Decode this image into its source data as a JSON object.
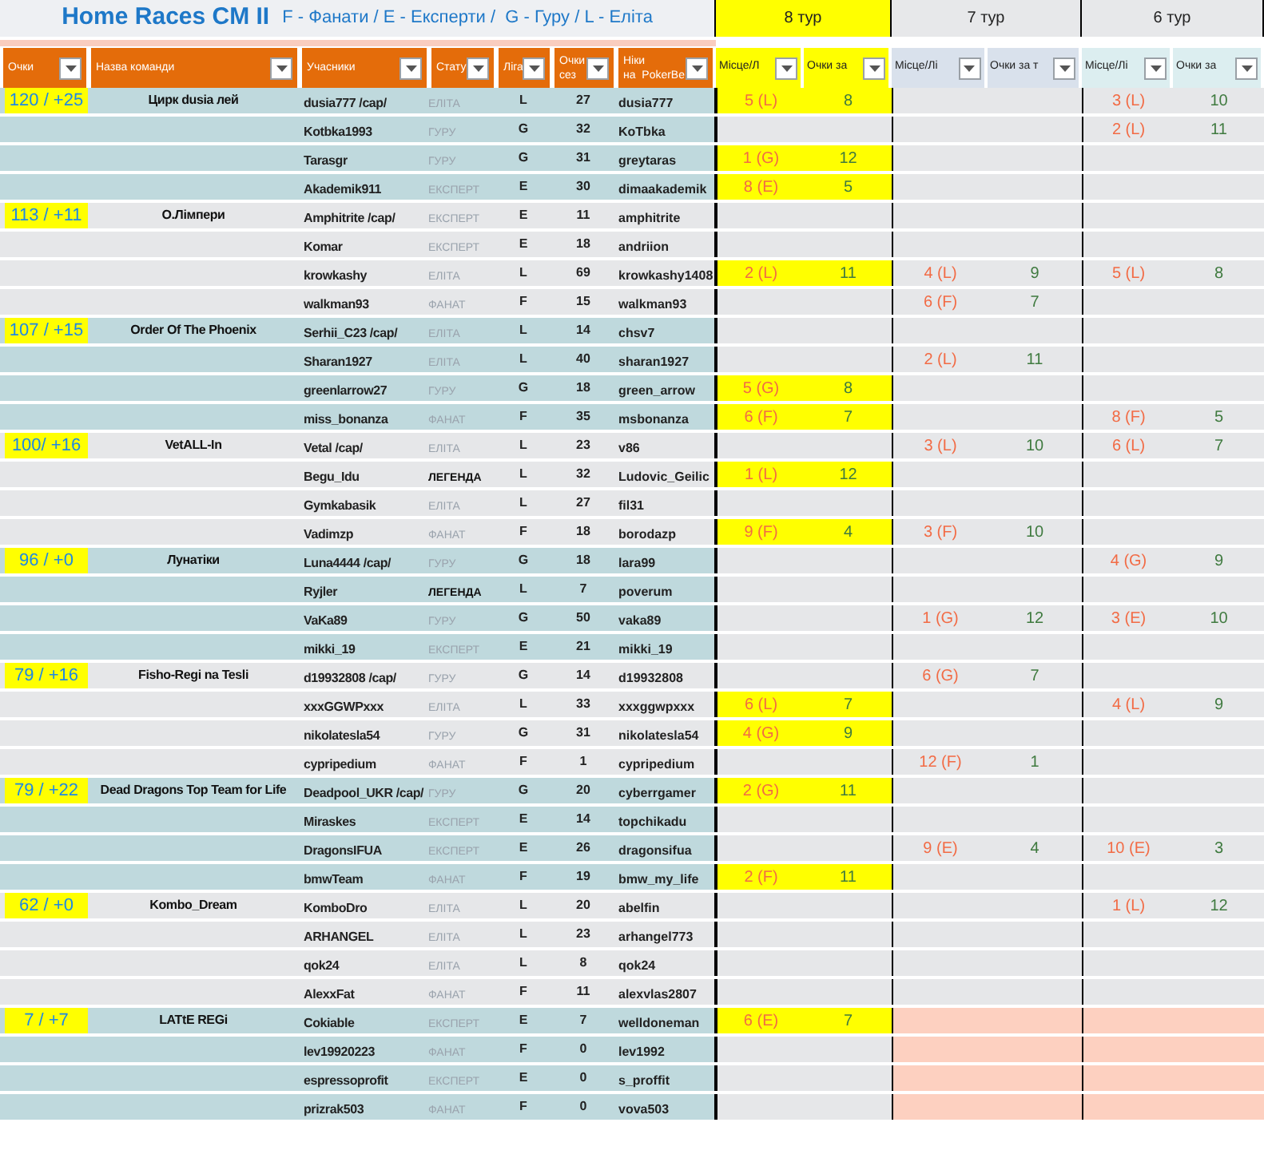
{
  "title": "Home Races CM II",
  "legend": "F - Фанати / E - Експерти /  G - Гуру / L - Еліта",
  "columns": [
    "Очки",
    "Назва команди",
    "Учасники",
    "Стату",
    "Ліга",
    "Очки\nсез",
    "Ніки\nна  PokerBe"
  ],
  "tours": [
    {
      "label": "8 тур",
      "current": true,
      "color": "#ffff00",
      "place_header": "Місце/Л",
      "points_header": "Очки за"
    },
    {
      "label": "7 тур",
      "current": false,
      "color": "#d9e1ec",
      "place_header": "Місце/Лі",
      "points_header": "Очки за т"
    },
    {
      "label": "6 тур",
      "current": false,
      "color": "#dceef0",
      "place_header": "Місце/Лі",
      "points_header": "Очки за"
    }
  ],
  "teams": [
    {
      "score": "120 / +25",
      "name": "Цирк dusia лей",
      "members": [
        {
          "name": "dusia777 /cap/",
          "status": "ЕЛІТА",
          "status_bold": false,
          "league": "L",
          "season": "27",
          "nick": "dusia777",
          "rounds": [
            {
              "kind": "result",
              "place": "5 (L)",
              "points": "8"
            },
            {
              "kind": "empty"
            },
            {
              "kind": "result",
              "place": "3 (L)",
              "points": "10"
            }
          ]
        },
        {
          "name": "Kotbka1993",
          "status": "ГУРУ",
          "status_bold": false,
          "league": "G",
          "season": "32",
          "nick": "KoTbka",
          "rounds": [
            {
              "kind": "empty"
            },
            {
              "kind": "empty"
            },
            {
              "kind": "result",
              "place": "2 (L)",
              "points": "11"
            }
          ]
        },
        {
          "name": "Tarasgr",
          "status": "ГУРУ",
          "status_bold": false,
          "league": "G",
          "season": "31",
          "nick": "greytaras",
          "rounds": [
            {
              "kind": "result",
              "place": "1 (G)",
              "points": "12"
            },
            {
              "kind": "empty"
            },
            {
              "kind": "empty"
            }
          ]
        },
        {
          "name": "Akademik911",
          "status": "ЕКСПЕРТ",
          "status_bold": false,
          "league": "E",
          "season": "30",
          "nick": "dimaakademik",
          "rounds": [
            {
              "kind": "result",
              "place": "8 (E)",
              "points": "5"
            },
            {
              "kind": "empty"
            },
            {
              "kind": "empty"
            }
          ]
        }
      ]
    },
    {
      "score": "113 / +11",
      "name": "О.Лімпери",
      "members": [
        {
          "name": "Amphitrite /cap/",
          "status": "ЕКСПЕРТ",
          "status_bold": false,
          "league": "E",
          "season": "11",
          "nick": "amphitrite",
          "rounds": [
            {
              "kind": "empty"
            },
            {
              "kind": "empty"
            },
            {
              "kind": "empty"
            }
          ]
        },
        {
          "name": "Komar",
          "status": "ЕКСПЕРТ",
          "status_bold": false,
          "league": "E",
          "season": "18",
          "nick": "andriion",
          "rounds": [
            {
              "kind": "empty"
            },
            {
              "kind": "empty"
            },
            {
              "kind": "empty"
            }
          ]
        },
        {
          "name": "krowkashy",
          "status": "ЕЛІТА",
          "status_bold": false,
          "league": "L",
          "season": "69",
          "nick": "krowkashy1408",
          "rounds": [
            {
              "kind": "result",
              "place": "2 (L)",
              "points": "11"
            },
            {
              "kind": "result",
              "place": "4 (L)",
              "points": "9"
            },
            {
              "kind": "result",
              "place": "5 (L)",
              "points": "8"
            }
          ]
        },
        {
          "name": "walkman93",
          "status": "ФАНАТ",
          "status_bold": false,
          "league": "F",
          "season": "15",
          "nick": "walkman93",
          "rounds": [
            {
              "kind": "empty"
            },
            {
              "kind": "result",
              "place": "6 (F)",
              "points": "7"
            },
            {
              "kind": "empty"
            }
          ]
        }
      ]
    },
    {
      "score": "107 / +15",
      "name": "Order Of The Phoenix",
      "members": [
        {
          "name": "Serhii_C23 /cap/",
          "status": "ЕЛІТА",
          "status_bold": false,
          "league": "L",
          "season": "14",
          "nick": "chsv7",
          "rounds": [
            {
              "kind": "empty"
            },
            {
              "kind": "empty"
            },
            {
              "kind": "empty"
            }
          ]
        },
        {
          "name": "Sharan1927",
          "status": "ЕЛІТА",
          "status_bold": false,
          "league": "L",
          "season": "40",
          "nick": "sharan1927",
          "rounds": [
            {
              "kind": "empty"
            },
            {
              "kind": "result",
              "place": "2 (L)",
              "points": "11"
            },
            {
              "kind": "empty"
            }
          ]
        },
        {
          "name": "greenlarrow27",
          "status": "ГУРУ",
          "status_bold": false,
          "league": "G",
          "season": "18",
          "nick": "green_arrow",
          "rounds": [
            {
              "kind": "result",
              "place": "5 (G)",
              "points": "8"
            },
            {
              "kind": "empty"
            },
            {
              "kind": "empty"
            }
          ]
        },
        {
          "name": "miss_bonanza",
          "status": "ФАНАТ",
          "status_bold": false,
          "league": "F",
          "season": "35",
          "nick": "msbonanza",
          "rounds": [
            {
              "kind": "result",
              "place": "6 (F)",
              "points": "7"
            },
            {
              "kind": "empty"
            },
            {
              "kind": "result",
              "place": "8 (F)",
              "points": "5"
            }
          ]
        }
      ]
    },
    {
      "score": "100/ +16",
      "name": "VetALL-In",
      "members": [
        {
          "name": "Vetal /cap/",
          "status": "ЕЛІТА",
          "status_bold": false,
          "league": "L",
          "season": "23",
          "nick": "v86",
          "rounds": [
            {
              "kind": "empty"
            },
            {
              "kind": "result",
              "place": "3 (L)",
              "points": "10"
            },
            {
              "kind": "result",
              "place": "6 (L)",
              "points": "7"
            }
          ]
        },
        {
          "name": "Begu_Idu",
          "status": "ЛЕГЕНДА",
          "status_bold": true,
          "league": "L",
          "season": "32",
          "nick": "Ludovic_Geilic",
          "rounds": [
            {
              "kind": "result",
              "place": "1 (L)",
              "points": "12"
            },
            {
              "kind": "empty"
            },
            {
              "kind": "empty"
            }
          ]
        },
        {
          "name": "Gymkabasik",
          "status": "ЕЛІТА",
          "status_bold": false,
          "league": "L",
          "season": "27",
          "nick": "fil31",
          "rounds": [
            {
              "kind": "empty"
            },
            {
              "kind": "empty"
            },
            {
              "kind": "empty"
            }
          ]
        },
        {
          "name": "Vadimzp",
          "status": "ФАНАТ",
          "status_bold": false,
          "league": "F",
          "season": "18",
          "nick": "borodazp",
          "rounds": [
            {
              "kind": "result",
              "place": "9 (F)",
              "points": "4"
            },
            {
              "kind": "result",
              "place": "3 (F)",
              "points": "10"
            },
            {
              "kind": "empty"
            }
          ]
        }
      ]
    },
    {
      "score": "96 / +0",
      "name": "Лунатіки",
      "members": [
        {
          "name": "Luna4444 /cap/",
          "status": "ГУРУ",
          "status_bold": false,
          "league": "G",
          "season": "18",
          "nick": "lara99",
          "rounds": [
            {
              "kind": "empty"
            },
            {
              "kind": "empty"
            },
            {
              "kind": "result",
              "place": "4 (G)",
              "points": "9"
            }
          ]
        },
        {
          "name": "Ryjler",
          "status": "ЛЕГЕНДА",
          "status_bold": true,
          "league": "L",
          "season": "7",
          "nick": "poverum",
          "rounds": [
            {
              "kind": "empty"
            },
            {
              "kind": "empty"
            },
            {
              "kind": "empty"
            }
          ]
        },
        {
          "name": "VaKa89",
          "status": "ГУРУ",
          "status_bold": false,
          "league": "G",
          "season": "50",
          "nick": "vaka89",
          "rounds": [
            {
              "kind": "empty"
            },
            {
              "kind": "result",
              "place": "1 (G)",
              "points": "12"
            },
            {
              "kind": "result",
              "place": "3 (E)",
              "points": "10"
            }
          ]
        },
        {
          "name": "mikki_19",
          "status": "ЕКСПЕРТ",
          "status_bold": false,
          "league": "E",
          "season": "21",
          "nick": "mikki_19",
          "rounds": [
            {
              "kind": "empty"
            },
            {
              "kind": "empty"
            },
            {
              "kind": "empty"
            }
          ]
        }
      ]
    },
    {
      "score": "79 / +16",
      "name": "Fisho-Regi na Tesli",
      "members": [
        {
          "name": "d19932808 /cap/",
          "status": "ГУРУ",
          "status_bold": false,
          "league": "G",
          "season": "14",
          "nick": "d19932808",
          "rounds": [
            {
              "kind": "empty"
            },
            {
              "kind": "result",
              "place": "6 (G)",
              "points": "7"
            },
            {
              "kind": "empty"
            }
          ]
        },
        {
          "name": "xxxGGWPxxx",
          "status": "ЕЛІТА",
          "status_bold": false,
          "league": "L",
          "season": "33",
          "nick": "xxxggwpxxx",
          "rounds": [
            {
              "kind": "result",
              "place": "6 (L)",
              "points": "7"
            },
            {
              "kind": "empty"
            },
            {
              "kind": "result",
              "place": "4 (L)",
              "points": "9"
            }
          ]
        },
        {
          "name": "nikolatesla54",
          "status": "ГУРУ",
          "status_bold": false,
          "league": "G",
          "season": "31",
          "nick": "nikolatesla54",
          "rounds": [
            {
              "kind": "result",
              "place": "4 (G)",
              "points": "9"
            },
            {
              "kind": "empty"
            },
            {
              "kind": "empty"
            }
          ]
        },
        {
          "name": "cypripedium",
          "status": "ФАНАТ",
          "status_bold": false,
          "league": "F",
          "season": "1",
          "nick": "cypripedium",
          "rounds": [
            {
              "kind": "empty"
            },
            {
              "kind": "result",
              "place": "12 (F)",
              "points": "1"
            },
            {
              "kind": "empty"
            }
          ]
        }
      ]
    },
    {
      "score": "79 / +22",
      "name": "Dead Dragons Top Team for Life",
      "members": [
        {
          "name": "Deadpool_UKR /cap/",
          "status": "ГУРУ",
          "status_bold": false,
          "league": "G",
          "season": "20",
          "nick": "cyberrgamer",
          "rounds": [
            {
              "kind": "result",
              "place": "2 (G)",
              "points": "11"
            },
            {
              "kind": "empty"
            },
            {
              "kind": "empty"
            }
          ]
        },
        {
          "name": "Miraskes",
          "status": "ЕКСПЕРТ",
          "status_bold": false,
          "league": "E",
          "season": "14",
          "nick": "topchikadu",
          "rounds": [
            {
              "kind": "empty"
            },
            {
              "kind": "empty"
            },
            {
              "kind": "empty"
            }
          ]
        },
        {
          "name": "DragonsIFUA",
          "status": "ЕКСПЕРТ",
          "status_bold": false,
          "league": "E",
          "season": "26",
          "nick": "dragonsifua",
          "rounds": [
            {
              "kind": "empty"
            },
            {
              "kind": "result",
              "place": "9 (E)",
              "points": "4"
            },
            {
              "kind": "result",
              "place": "10 (E)",
              "points": "3"
            }
          ]
        },
        {
          "name": "bmwTeam",
          "status": "ФАНАТ",
          "status_bold": false,
          "league": "F",
          "season": "19",
          "nick": "bmw_my_life",
          "rounds": [
            {
              "kind": "result",
              "place": "2 (F)",
              "points": "11"
            },
            {
              "kind": "empty"
            },
            {
              "kind": "empty"
            }
          ]
        }
      ]
    },
    {
      "score": "62 / +0",
      "name": "Kombo_Dream",
      "members": [
        {
          "name": "KomboDro",
          "status": "ЕЛІТА",
          "status_bold": false,
          "league": "L",
          "season": "20",
          "nick": "abelfin",
          "rounds": [
            {
              "kind": "empty"
            },
            {
              "kind": "empty"
            },
            {
              "kind": "result",
              "place": "1 (L)",
              "points": "12"
            }
          ]
        },
        {
          "name": "ARHANGEL",
          "status": "ЕЛІТА",
          "status_bold": false,
          "league": "L",
          "season": "23",
          "nick": "arhangel773",
          "rounds": [
            {
              "kind": "empty"
            },
            {
              "kind": "empty"
            },
            {
              "kind": "empty"
            }
          ]
        },
        {
          "name": "qok24",
          "status": "ЕЛІТА",
          "status_bold": false,
          "league": "L",
          "season": "8",
          "nick": "qok24",
          "rounds": [
            {
              "kind": "empty"
            },
            {
              "kind": "empty"
            },
            {
              "kind": "empty"
            }
          ]
        },
        {
          "name": "AlexxFat",
          "status": "ФАНАТ",
          "status_bold": false,
          "league": "F",
          "season": "11",
          "nick": "alexvlas2807",
          "rounds": [
            {
              "kind": "empty"
            },
            {
              "kind": "empty"
            },
            {
              "kind": "empty"
            }
          ]
        }
      ]
    },
    {
      "score": "7 / +7",
      "name": "LATtE REGi",
      "members": [
        {
          "name": "Cokiable",
          "status": "ЕКСПЕРТ",
          "status_bold": false,
          "league": "E",
          "season": "7",
          "nick": "welldoneman",
          "rounds": [
            {
              "kind": "result",
              "place": "6 (E)",
              "points": "7"
            },
            {
              "kind": "absent"
            },
            {
              "kind": "absent"
            }
          ]
        },
        {
          "name": "lev19920223",
          "status": "ФАНАТ",
          "status_bold": false,
          "league": "F",
          "season": "0",
          "nick": "lev1992",
          "rounds": [
            {
              "kind": "empty"
            },
            {
              "kind": "absent"
            },
            {
              "kind": "absent"
            }
          ]
        },
        {
          "name": "espressoprofit",
          "status": "ЕКСПЕРТ",
          "status_bold": false,
          "league": "E",
          "season": "0",
          "nick": "s_proffit",
          "rounds": [
            {
              "kind": "empty"
            },
            {
              "kind": "absent"
            },
            {
              "kind": "absent"
            }
          ]
        },
        {
          "name": "prizrak503",
          "status": "ФАНАТ",
          "status_bold": false,
          "league": "F",
          "season": "0",
          "nick": "vova503",
          "rounds": [
            {
              "kind": "empty"
            },
            {
              "kind": "absent"
            },
            {
              "kind": "absent"
            }
          ]
        }
      ]
    }
  ]
}
